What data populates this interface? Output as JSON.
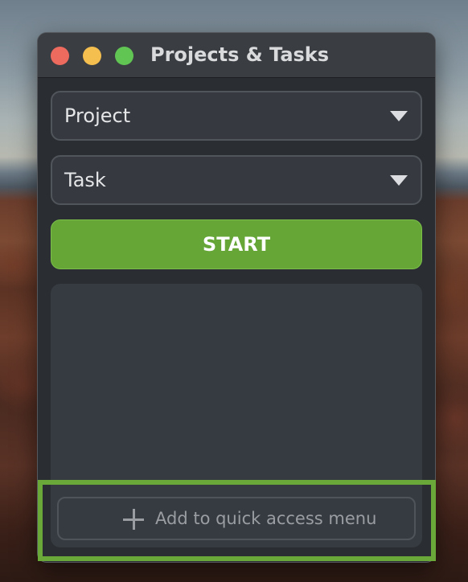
{
  "window": {
    "title": "Projects & Tasks"
  },
  "project_select": {
    "value": "Project",
    "icon": "caret-down-icon"
  },
  "task_select": {
    "value": "Task",
    "icon": "caret-down-icon"
  },
  "start_button": {
    "label": "START"
  },
  "quick_access": {
    "label": "Add to quick access menu",
    "icon": "plus-icon"
  },
  "colors": {
    "accent_green": "#65a637",
    "highlight_green": "#6aa83a",
    "window_bg": "#2a2e33",
    "panel_bg": "#363b41"
  }
}
